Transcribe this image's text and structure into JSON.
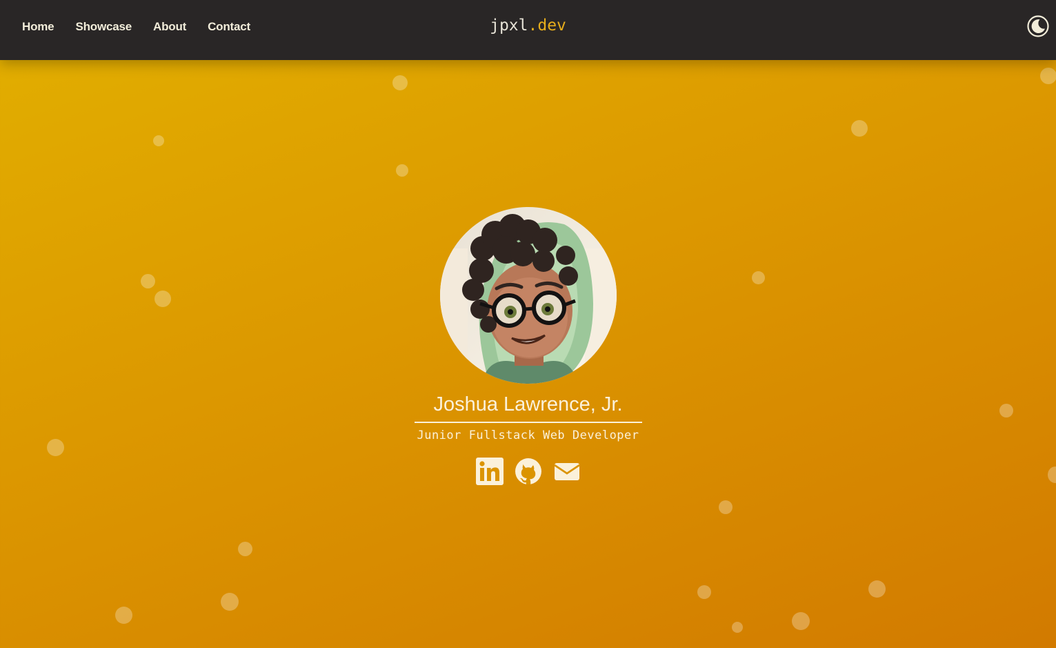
{
  "nav": {
    "links": [
      "Home",
      "Showcase",
      "About",
      "Contact"
    ],
    "brand_main": "jpxl",
    "brand_accent": ".dev",
    "theme_icon": "moon-icon"
  },
  "profile": {
    "name": "Joshua Lawrence, Jr.",
    "title": "Junior Fullstack Web Developer",
    "avatar": "cartoon-avatar-image"
  },
  "socials": [
    {
      "icon": "linkedin-icon"
    },
    {
      "icon": "github-icon"
    },
    {
      "icon": "mail-icon"
    }
  ],
  "colors": {
    "navbar_bg": "#292626",
    "brand_accent": "#e6ad1c",
    "background_top": "#e2b000",
    "background_bottom": "#d27a00",
    "text_light": "#fbf1da"
  }
}
